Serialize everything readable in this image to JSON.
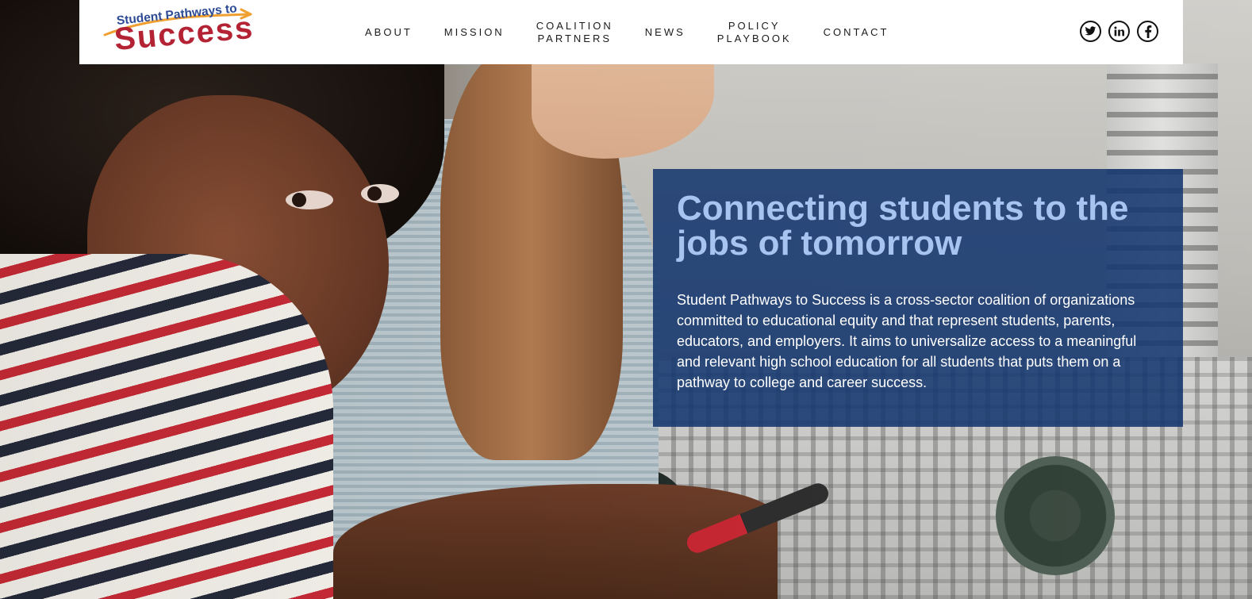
{
  "header": {
    "logo": {
      "line1": "Student Pathways to",
      "line2": "Success"
    },
    "nav": [
      {
        "label": "ABOUT"
      },
      {
        "label": "MISSION"
      },
      {
        "label": "COALITION\nPARTNERS"
      },
      {
        "label": "NEWS"
      },
      {
        "label": "POLICY\nPLAYBOOK"
      },
      {
        "label": "CONTACT"
      }
    ],
    "social": [
      "twitter-icon",
      "linkedin-icon",
      "facebook-icon"
    ]
  },
  "hero": {
    "headline": "Connecting students to the jobs of tomorrow",
    "body": "Student Pathways to Success is a cross-sector coalition of organizations committed to educational equity and that represent students, parents, educators, and employers. It aims to universalize access to a meaningful and relevant high school education for all students that puts them on a pathway to college and career success."
  },
  "colors": {
    "panel_bg": "#14376e",
    "headline": "#a7c3ef",
    "logo_blue": "#2d4b94",
    "logo_red": "#b42334",
    "logo_swoosh": "#f0a030"
  }
}
